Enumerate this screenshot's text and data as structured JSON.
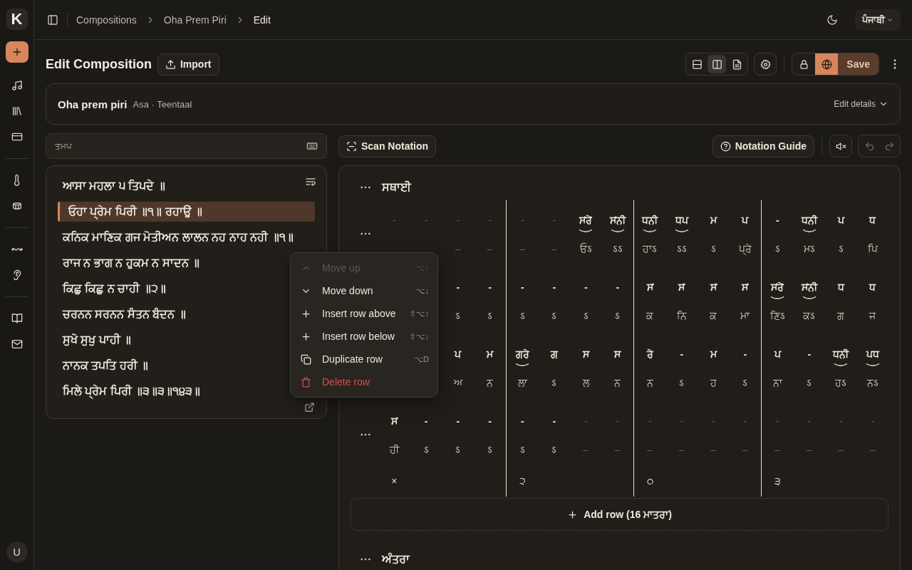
{
  "app": {
    "logo": "K",
    "avatar": "U"
  },
  "breadcrumbs": [
    {
      "label": "Compositions",
      "current": false
    },
    {
      "label": "Oha Prem Piri",
      "current": false
    },
    {
      "label": "Edit",
      "current": true
    }
  ],
  "language": "ਪੰਜਾਬੀ",
  "header": {
    "title": "Edit Composition",
    "import": "Import",
    "save": "Save",
    "view_modes": [
      {
        "selected": false
      },
      {
        "selected": true
      },
      {
        "selected": false
      }
    ],
    "access": [
      {
        "selected": false
      },
      {
        "selected": true
      }
    ]
  },
  "details": {
    "title": "Oha prem piri",
    "subtitle": "Asa · Teentaal",
    "edit": "Edit details"
  },
  "search": {
    "placeholder": "ਤਮਪ"
  },
  "scan_button": "Scan Notation",
  "guide_button": "Notation Guide",
  "muted": true,
  "undo": {
    "disabled": true
  },
  "redo": {
    "disabled": true
  },
  "lyrics": [
    {
      "text": "ਆਸਾ ਮਹਲਾ ੫ ਤਿਪਦੇ ॥",
      "selected": false
    },
    {
      "text": "ਓਹਾ ਪ੍ਰੇਮ ਪਿਰੀ ॥੧॥ ਰਹਾਉ ॥",
      "selected": true
    },
    {
      "text": "ਕਨਿਕ ਮਾਣਿਕ ਗਜ ਮੋਤੀਅਨ ਲਾਲਨ ਨਹ ਨਾਹ ਨਹੀ ॥੧॥",
      "selected": false
    },
    {
      "text": "ਰਾਜ ਨ ਭਾਗ ਨ ਹੁਕਮ ਨ ਸਾਦਨ ॥",
      "selected": false
    },
    {
      "text": "ਕਿਛੁ ਕਿਛੁ ਨ ਚਾਹੀ ॥੨॥",
      "selected": false
    },
    {
      "text": "ਚਰਨਨ ਸਰਨਨ ਸੰਤਨ ਬੰਦਨ ॥",
      "selected": false
    },
    {
      "text": "ਸੁਖੋ ਸੁਖੁ ਪਾਹੀ ॥",
      "selected": false
    },
    {
      "text": "ਨਾਨਕ ਤਪਤਿ ਹਰੀ ॥",
      "selected": false
    },
    {
      "text": "ਮਿਲੇ ਪ੍ਰੇਮ ਪਿਰੀ ॥੩॥੩॥੧੪੩॥",
      "selected": false
    }
  ],
  "menu": [
    {
      "label": "Move up",
      "shortcut": "⌥↑",
      "kind": "up",
      "disabled": true
    },
    {
      "label": "Move down",
      "shortcut": "⌥↓",
      "kind": "down",
      "disabled": false
    },
    {
      "label": "Insert row above",
      "shortcut": "⇧⌥↑",
      "kind": "insert",
      "disabled": false
    },
    {
      "label": "Insert row below",
      "shortcut": "⇧⌥↓",
      "kind": "insert",
      "disabled": false
    },
    {
      "label": "Duplicate row",
      "shortcut": "⌥D",
      "kind": "duplicate",
      "disabled": false
    },
    {
      "label": "Delete row",
      "kind": "delete",
      "disabled": false
    }
  ],
  "notation": {
    "sections": [
      {
        "title": "ਸਥਾਈ",
        "add_row": "Add row (16 ਮਾਤਰਾ)",
        "taal_marks": [
          "×",
          "੨",
          "੦",
          "੩"
        ],
        "rows": [
          {
            "more_button": true,
            "swar": [
              {
                "n": "-",
                "dim": true,
                "slur": false
              },
              {
                "n": "-",
                "dim": true,
                "slur": false
              },
              {
                "n": "-",
                "dim": true,
                "slur": false
              },
              {
                "n": "-",
                "dim": true,
                "slur": false
              },
              {
                "n": "-",
                "dim": true,
                "slur": false
              },
              {
                "n": "-",
                "dim": true,
                "slur": false
              },
              {
                "n": "ਸਂਰੇਂ",
                "dim": false,
                "slur": true
              },
              {
                "n": "ਸਂਨੀ",
                "dim": false,
                "slur": true
              },
              {
                "n": "ਧਨੀ",
                "dim": false,
                "slur": true
              },
              {
                "n": "ਧਪ",
                "dim": false,
                "slur": true
              },
              {
                "n": "ਮ",
                "dim": false,
                "slur": false
              },
              {
                "n": "ਪ",
                "dim": false,
                "slur": false
              },
              {
                "n": "-",
                "dim": false,
                "slur": false
              },
              {
                "n": "ਧਨੀ",
                "dim": false,
                "slur": true
              },
              {
                "n": "ਪ",
                "dim": false,
                "slur": false
              },
              {
                "n": "ਧ",
                "dim": false,
                "slur": false
              }
            ],
            "lyrics": [
              {
                "n": "–",
                "dim": true
              },
              {
                "n": "–",
                "dim": true
              },
              {
                "n": "–",
                "dim": true
              },
              {
                "n": "–",
                "dim": true
              },
              {
                "n": "ਓऽ",
                "dim": false
              },
              {
                "n": "ऽऽ",
                "dim": false
              },
              {
                "n": "ਹਾऽ",
                "dim": false
              },
              {
                "n": "ऽऽ",
                "dim": false
              },
              {
                "n": "ऽ",
                "dim": false
              },
              {
                "n": "ਪ੍ਰੇ",
                "dim": false
              },
              {
                "n": "ऽ",
                "dim": false
              },
              {
                "n": "ਮऽ",
                "dim": false
              },
              {
                "n": "ऽ",
                "dim": false
              },
              {
                "n": "ਪਿ",
                "dim": false
              }
            ]
          },
          {
            "more_button": false,
            "swar": [
              {
                "n": "-",
                "dim": false,
                "slur": false
              },
              {
                "n": "-",
                "dim": false,
                "slur": false
              },
              {
                "n": "-",
                "dim": false,
                "slur": false
              },
              {
                "n": "-",
                "dim": false,
                "slur": false
              },
              {
                "n": "-",
                "dim": false,
                "slur": false
              },
              {
                "n": "-",
                "dim": false,
                "slur": false
              },
              {
                "n": "ਸਂ",
                "dim": false,
                "slur": false
              },
              {
                "n": "ਸਂ",
                "dim": false,
                "slur": false
              },
              {
                "n": "ਸਂ",
                "dim": false,
                "slur": false
              },
              {
                "n": "ਸਂ",
                "dim": false,
                "slur": false
              },
              {
                "n": "ਸਂਰੇਂ",
                "dim": false,
                "slur": true
              },
              {
                "n": "ਸਂਨੀ",
                "dim": false,
                "slur": true
              },
              {
                "n": "ਧ",
                "dim": false,
                "slur": false
              },
              {
                "n": "ਧ",
                "dim": false,
                "slur": false
              }
            ],
            "lyrics": [
              {
                "n": "ऽ",
                "dim": false
              },
              {
                "n": "ऽ",
                "dim": false
              },
              {
                "n": "ऽ",
                "dim": false
              },
              {
                "n": "ऽ",
                "dim": false
              },
              {
                "n": "ऽ",
                "dim": false
              },
              {
                "n": "ऽ",
                "dim": false
              },
              {
                "n": "ਕ",
                "dim": false
              },
              {
                "n": "ਨਿ",
                "dim": false
              },
              {
                "n": "ਕ",
                "dim": false
              },
              {
                "n": "ਮਾ",
                "dim": false
              },
              {
                "n": "ਣਿऽ",
                "dim": false
              },
              {
                "n": "ਕऽ",
                "dim": false
              },
              {
                "n": "ਗ",
                "dim": false
              },
              {
                "n": "ਜ",
                "dim": false
              }
            ]
          },
          {
            "more_button": false,
            "swar": [
              {
                "n": "ਪ",
                "dim": false,
                "slur": false
              },
              {
                "n": "ਮ",
                "dim": false,
                "slur": false
              },
              {
                "n": "ਗਰੇ",
                "dim": false,
                "slur": true
              },
              {
                "n": "ਗ",
                "dim": false,
                "slur": false
              },
              {
                "n": "ਸ",
                "dim": false,
                "slur": false
              },
              {
                "n": "ਸ",
                "dim": false,
                "slur": false
              },
              {
                "n": "ਰੇ",
                "dim": false,
                "slur": false
              },
              {
                "n": "-",
                "dim": false,
                "slur": false
              },
              {
                "n": "ਮ",
                "dim": false,
                "slur": false
              },
              {
                "n": "-",
                "dim": false,
                "slur": false
              },
              {
                "n": "ਪ",
                "dim": false,
                "slur": false
              },
              {
                "n": "-",
                "dim": false,
                "slur": false
              },
              {
                "n": "ਧਨੀ",
                "dim": false,
                "slur": true
              },
              {
                "n": "ਪਧ",
                "dim": false,
                "slur": true
              }
            ],
            "lyrics": [
              {
                "n": "ਅ",
                "dim": false
              },
              {
                "n": "ਨ",
                "dim": false
              },
              {
                "n": "ਲਾ",
                "dim": false
              },
              {
                "n": "ऽ",
                "dim": false
              },
              {
                "n": "ਲ",
                "dim": false
              },
              {
                "n": "ਨ",
                "dim": false
              },
              {
                "n": "ਨ",
                "dim": false
              },
              {
                "n": "ऽ",
                "dim": false
              },
              {
                "n": "ਹ",
                "dim": false
              },
              {
                "n": "ऽ",
                "dim": false
              },
              {
                "n": "ਨਾ",
                "dim": false
              },
              {
                "n": "ऽ",
                "dim": false
              },
              {
                "n": "ਹऽ",
                "dim": false
              },
              {
                "n": "ਨऽ",
                "dim": false
              }
            ]
          },
          {
            "more_button": true,
            "swar": [
              {
                "n": "ਸਂ",
                "dim": false,
                "slur": false
              },
              {
                "n": "-",
                "dim": false,
                "slur": false
              },
              {
                "n": "-",
                "dim": false,
                "slur": false
              },
              {
                "n": "-",
                "dim": false,
                "slur": false
              },
              {
                "n": "-",
                "dim": false,
                "slur": false
              },
              {
                "n": "-",
                "dim": false,
                "slur": false
              },
              {
                "n": "-",
                "dim": true,
                "slur": false
              },
              {
                "n": "-",
                "dim": true,
                "slur": false
              },
              {
                "n": "-",
                "dim": true,
                "slur": false
              },
              {
                "n": "-",
                "dim": true,
                "slur": false
              },
              {
                "n": "-",
                "dim": true,
                "slur": false
              },
              {
                "n": "-",
                "dim": true,
                "slur": false
              },
              {
                "n": "-",
                "dim": true,
                "slur": false
              },
              {
                "n": "-",
                "dim": true,
                "slur": false
              },
              {
                "n": "-",
                "dim": true,
                "slur": false
              },
              {
                "n": "-",
                "dim": true,
                "slur": false
              }
            ],
            "lyrics": [
              {
                "n": "ਹੀ",
                "dim": false
              },
              {
                "n": "ऽ",
                "dim": false
              },
              {
                "n": "ऽ",
                "dim": false
              },
              {
                "n": "ऽ",
                "dim": false
              },
              {
                "n": "ऽ",
                "dim": false
              },
              {
                "n": "ऽ",
                "dim": false
              },
              {
                "n": "–",
                "dim": true
              },
              {
                "n": "–",
                "dim": true
              },
              {
                "n": "–",
                "dim": true
              },
              {
                "n": "–",
                "dim": true
              },
              {
                "n": "–",
                "dim": true
              },
              {
                "n": "–",
                "dim": true
              },
              {
                "n": "–",
                "dim": true
              },
              {
                "n": "–",
                "dim": true
              },
              {
                "n": "–",
                "dim": true
              },
              {
                "n": "–",
                "dim": true
              }
            ]
          }
        ]
      },
      {
        "title": "ਅੰਤਰਾ"
      }
    ]
  }
}
